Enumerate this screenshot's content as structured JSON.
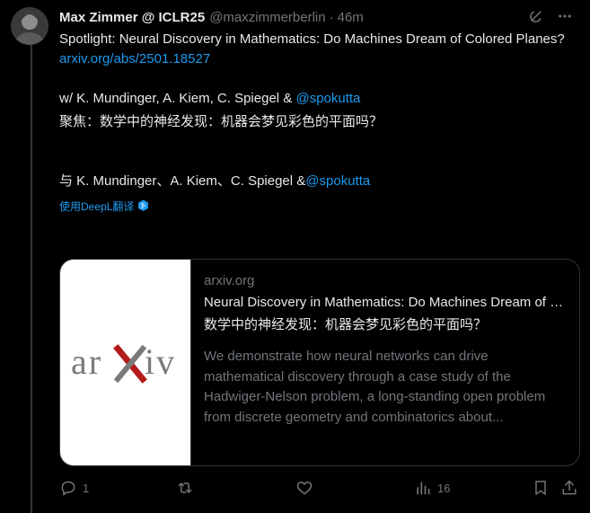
{
  "author": {
    "name": "Max Zimmer @ ICLR25",
    "handle": "@maxzimmerberlin",
    "separator": "·",
    "time": "46m"
  },
  "tweet": {
    "line1": "Spotlight: Neural Discovery in Mathematics: Do Machines Dream of Colored Planes?",
    "link": "arxiv.org/abs/2501.18527",
    "coauthors_prefix": "w/ K. Mundinger, A. Kiem, C. Spiegel & ",
    "coauthors_mention": "@spokutta",
    "zh_line1": "聚焦：数学中的神经发现：机器会梦见彩色的平面吗？",
    "zh_coauthors_prefix": "与 K. Mundinger、A. Kiem、C. Spiegel &",
    "zh_coauthors_mention": "@spokutta",
    "translate_label": "使用DeepL翻译"
  },
  "card": {
    "domain": "arxiv.org",
    "title": "Neural Discovery in Mathematics: Do Machines Dream of Colored Planes?",
    "title_zh": "数学中的神经发现：机器会梦见彩色的平面吗？",
    "description": "We demonstrate how neural networks can drive mathematical discovery through a case study of the Hadwiger-Nelson problem, a long-standing open problem from discrete geometry and combinatorics about...",
    "thumb_logo": "arXiv"
  },
  "actions": {
    "reply_count": "1",
    "retweet_count": "",
    "like_count": "",
    "views_count": "16"
  },
  "colors": {
    "link": "#1d9bf0",
    "muted": "#71767b",
    "text": "#e7e9ea",
    "background": "#000000",
    "arxiv_red": "#b31b1b",
    "arxiv_gray": "#7a7a7a"
  },
  "icons": {
    "grok": "grok-icon",
    "more": "more-icon",
    "deepl": "deepl-icon",
    "reply": "reply-icon",
    "retweet": "retweet-icon",
    "like": "heart-icon",
    "views": "views-icon",
    "bookmark": "bookmark-icon",
    "share": "share-icon"
  }
}
